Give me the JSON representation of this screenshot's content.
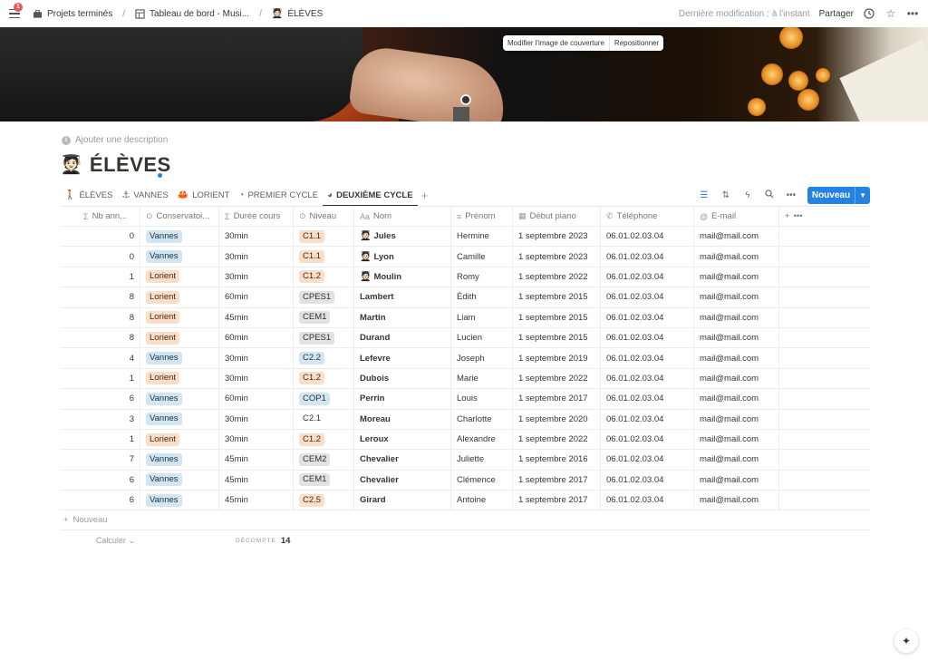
{
  "topbar": {
    "notifications": "1",
    "breadcrumbs": [
      "Projets terminés",
      "Tableau de bord - Musi...",
      "ÉLÈVES"
    ],
    "last_modified": "Dernière modification : à l'instant",
    "share": "Partager"
  },
  "cover": {
    "change": "Modifier l'image de couverture",
    "reposition": "Repositionner"
  },
  "page": {
    "description": "Ajouter une description",
    "emoji": "🧑🏻‍🎓",
    "title": "ÉLÈVES"
  },
  "tabs": [
    {
      "label": "ÉLÈVES",
      "icon": "person-icon",
      "glyph": "🚶"
    },
    {
      "label": "VANNES",
      "icon": "anchor-icon",
      "glyph": "⚓"
    },
    {
      "label": "LORIENT",
      "icon": "crab-icon",
      "glyph": "🦀"
    },
    {
      "label": "PREMIER CYCLE",
      "icon": "progress-circle-icon",
      "glyph": "◔"
    },
    {
      "label": "DEUXIÈME CYCLE",
      "icon": "progress-circle-icon",
      "glyph": "◕"
    }
  ],
  "active_tab": "DEUXIÈME CYCLE",
  "toolbar": {
    "new_label": "Nouveau",
    "accent": "#2383e2"
  },
  "columns": [
    {
      "label": "Nb ann...",
      "icon": "sum-icon",
      "glyph": "Σ"
    },
    {
      "label": "Conservatoi...",
      "icon": "status-icon",
      "glyph": "⊙"
    },
    {
      "label": "Durée cours",
      "icon": "sum-icon",
      "glyph": "Σ"
    },
    {
      "label": "Niveau",
      "icon": "status-icon",
      "glyph": "⊙"
    },
    {
      "label": "Nom",
      "icon": "text-icon",
      "glyph": "Aa"
    },
    {
      "label": "Prénom",
      "icon": "lines-icon",
      "glyph": "≡"
    },
    {
      "label": "Début piano",
      "icon": "calendar-icon",
      "glyph": "▦"
    },
    {
      "label": "Téléphone",
      "icon": "phone-icon",
      "glyph": "✆"
    },
    {
      "label": "E-mail",
      "icon": "at-icon",
      "glyph": "@"
    }
  ],
  "rows": [
    {
      "nb": "0",
      "cons": "Vannes",
      "dur": "30min",
      "niv": "C1.1",
      "niv_color": "orange",
      "emoji": "🧑🏻‍🎓",
      "nom": "Jules",
      "prenom": "Hermine",
      "debut": "1 septembre 2023",
      "tel": "06.01.02.03.04",
      "mail": "mail@mail.com"
    },
    {
      "nb": "0",
      "cons": "Vannes",
      "dur": "30min",
      "niv": "C1.1",
      "niv_color": "orange",
      "emoji": "🧑🏻‍🎓",
      "nom": "Lyon",
      "prenom": "Camille",
      "debut": "1 septembre 2023",
      "tel": "06.01.02.03.04",
      "mail": "mail@mail.com"
    },
    {
      "nb": "1",
      "cons": "Lorient",
      "dur": "30min",
      "niv": "C1.2",
      "niv_color": "orange",
      "emoji": "🧑🏻‍🎓",
      "nom": "Moulin",
      "prenom": "Romy",
      "debut": "1 septembre 2022",
      "tel": "06.01.02.03.04",
      "mail": "mail@mail.com"
    },
    {
      "nb": "8",
      "cons": "Lorient",
      "dur": "60min",
      "niv": "CPES1",
      "niv_color": "gray",
      "emoji": "",
      "nom": "Lambert",
      "prenom": "Édith",
      "debut": "1 septembre 2015",
      "tel": "06.01.02.03.04",
      "mail": "mail@mail.com"
    },
    {
      "nb": "8",
      "cons": "Lorient",
      "dur": "45min",
      "niv": "CEM1",
      "niv_color": "gray",
      "emoji": "",
      "nom": "Martin",
      "prenom": "Liam",
      "debut": "1 septembre 2015",
      "tel": "06.01.02.03.04",
      "mail": "mail@mail.com"
    },
    {
      "nb": "8",
      "cons": "Lorient",
      "dur": "60min",
      "niv": "CPES1",
      "niv_color": "gray",
      "emoji": "",
      "nom": "Durand",
      "prenom": "Lucien",
      "debut": "1 septembre 2015",
      "tel": "06.01.02.03.04",
      "mail": "mail@mail.com"
    },
    {
      "nb": "4",
      "cons": "Vannes",
      "dur": "30min",
      "niv": "C2.2",
      "niv_color": "blue",
      "emoji": "",
      "nom": "Lefevre",
      "prenom": "Joseph",
      "debut": "1 septembre 2019",
      "tel": "06.01.02.03.04",
      "mail": "mail@mail.com"
    },
    {
      "nb": "1",
      "cons": "Lorient",
      "dur": "30min",
      "niv": "C1.2",
      "niv_color": "orange",
      "emoji": "",
      "nom": "Dubois",
      "prenom": "Marie",
      "debut": "1 septembre 2022",
      "tel": "06.01.02.03.04",
      "mail": "mail@mail.com"
    },
    {
      "nb": "6",
      "cons": "Vannes",
      "dur": "60min",
      "niv": "COP1",
      "niv_color": "blue",
      "emoji": "",
      "nom": "Perrin",
      "prenom": "Louis",
      "debut": "1 septembre 2017",
      "tel": "06.01.02.03.04",
      "mail": "mail@mail.com"
    },
    {
      "nb": "3",
      "cons": "Vannes",
      "dur": "30min",
      "niv": "C2.1",
      "niv_color": "none",
      "emoji": "",
      "nom": "Moreau",
      "prenom": "Charlotte",
      "debut": "1 septembre 2020",
      "tel": "06.01.02.03.04",
      "mail": "mail@mail.com"
    },
    {
      "nb": "1",
      "cons": "Lorient",
      "dur": "30min",
      "niv": "C1.2",
      "niv_color": "orange",
      "emoji": "",
      "nom": "Leroux",
      "prenom": "Alexandre",
      "debut": "1 septembre 2022",
      "tel": "06.01.02.03.04",
      "mail": "mail@mail.com"
    },
    {
      "nb": "7",
      "cons": "Vannes",
      "dur": "45min",
      "niv": "CEM2",
      "niv_color": "gray",
      "emoji": "",
      "nom": "Chevalier",
      "prenom": "Juliette",
      "debut": "1 septembre 2016",
      "tel": "06.01.02.03.04",
      "mail": "mail@mail.com"
    },
    {
      "nb": "6",
      "cons": "Vannes",
      "dur": "45min",
      "niv": "CEM1",
      "niv_color": "gray",
      "emoji": "",
      "nom": "Chevalier",
      "prenom": "Clémence",
      "debut": "1 septembre 2017",
      "tel": "06.01.02.03.04",
      "mail": "mail@mail.com"
    },
    {
      "nb": "6",
      "cons": "Vannes",
      "dur": "45min",
      "niv": "C2.5",
      "niv_color": "orange",
      "emoji": "",
      "nom": "Girard",
      "prenom": "Antoine",
      "debut": "1 septembre 2017",
      "tel": "06.01.02.03.04",
      "mail": "mail@mail.com"
    }
  ],
  "table_footer": {
    "add_row": "Nouveau",
    "calculate": "Calculer",
    "count_label": "DÉCOMPTE",
    "count_value": "14"
  }
}
